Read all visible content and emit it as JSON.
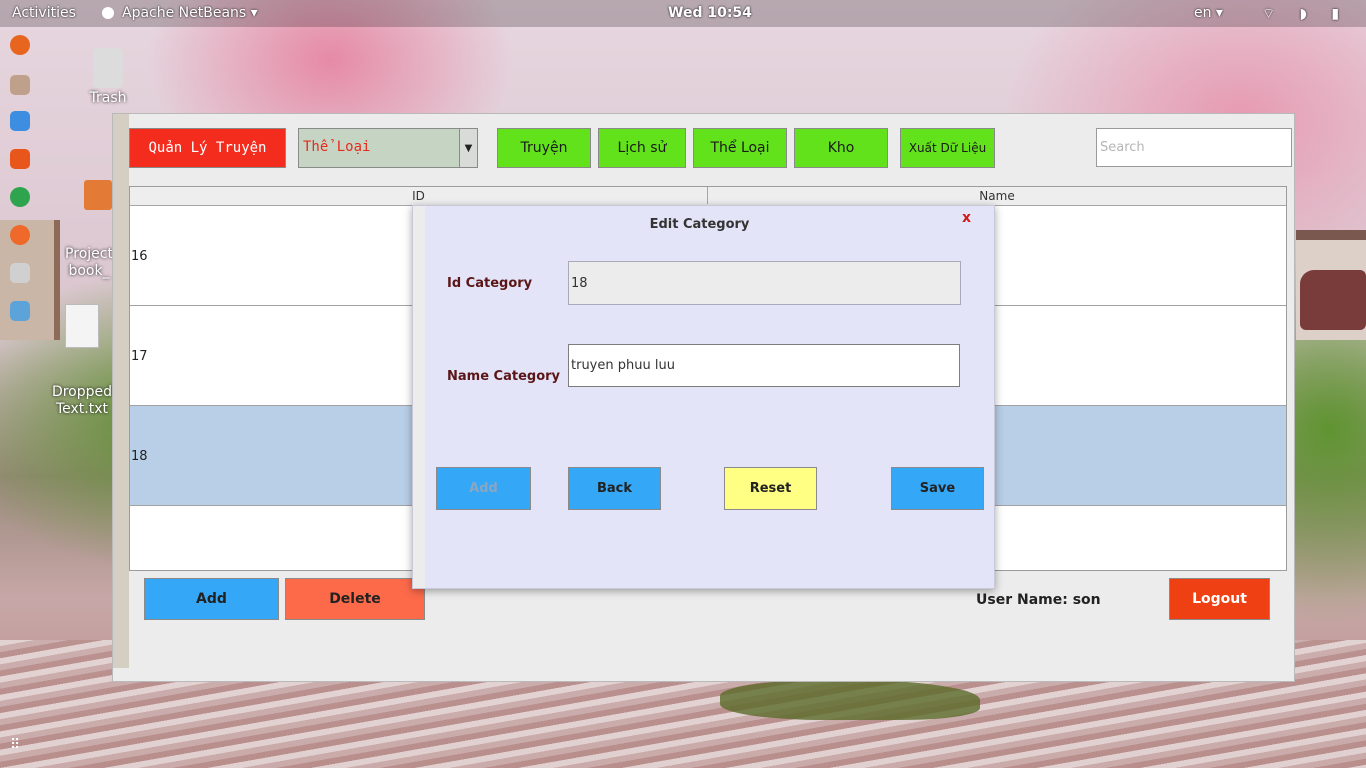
{
  "topbar": {
    "activities": "Activities",
    "app_name": "Apache NetBeans ▾",
    "clock": "Wed 10:54",
    "language": "en ▾",
    "system_icons": "⌔ ◗ ▮"
  },
  "desktop": {
    "icons": [
      {
        "label": "Trash"
      },
      {
        "label": "Project\nbook_"
      },
      {
        "label": "Dropped\nText.txt"
      }
    ]
  },
  "app": {
    "nav": {
      "main_button": "Quản Lý Truyện",
      "combo_value": "Thể Loại",
      "combo_arrow": "▼",
      "buttons": [
        "Truyện",
        "Lịch sử",
        "Thể Loại",
        "Kho",
        "Xuất Dữ Liệu"
      ],
      "search_placeholder": "Search"
    },
    "table": {
      "columns": [
        "ID",
        "Name"
      ],
      "rows": [
        {
          "id": "16",
          "name": ""
        },
        {
          "id": "17",
          "name": ""
        },
        {
          "id": "18",
          "name": "",
          "selected": true
        }
      ]
    },
    "bottom": {
      "add_label": "Add",
      "delete_label": "Delete",
      "user_name": "User Name: son",
      "logout_label": "Logout"
    }
  },
  "dialog": {
    "title": "Edit Category",
    "close": "x",
    "id_label": "Id Category",
    "id_value": "18",
    "name_label": "Name Category",
    "name_value": "truyen phuu luu",
    "buttons": {
      "add": "Add",
      "back": "Back",
      "reset": "Reset",
      "save": "Save"
    }
  },
  "colors": {
    "red_button": "#f42c1e",
    "green_button": "#62e21b",
    "blue_button": "#35a7f7",
    "delete_button": "#fd6a4a",
    "logout_button": "#ee4012",
    "reset_button": "#ffff84",
    "selected_row": "#b8cfe7",
    "dialog_bg": "#e4e4f8"
  }
}
